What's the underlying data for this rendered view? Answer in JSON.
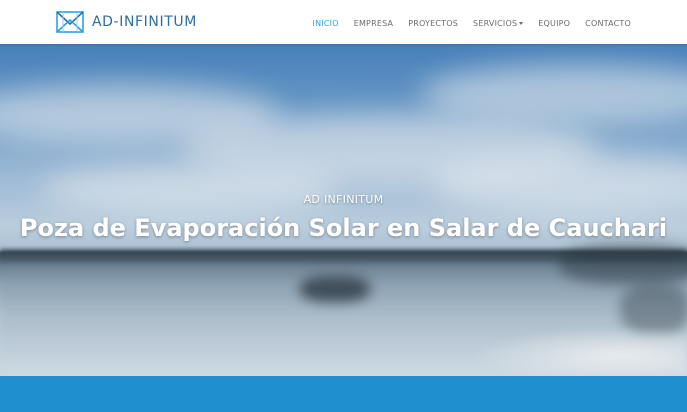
{
  "brand": {
    "name": "AD-INFINITUM",
    "logo_icon": "ad-infinitum-logo-icon",
    "color": "#2b6f9e"
  },
  "nav": {
    "items": [
      {
        "label": "INICIO",
        "active": true
      },
      {
        "label": "EMPRESA",
        "active": false
      },
      {
        "label": "PROYECTOS",
        "active": false
      },
      {
        "label": "SERVICIOS",
        "active": false,
        "dropdown": true
      },
      {
        "label": "EQUIPO",
        "active": false
      },
      {
        "label": "CONTACTO",
        "active": false
      }
    ],
    "active_color": "#2aa3e0",
    "text_color": "#6b6b6b"
  },
  "hero": {
    "subtitle": "AD INFINITUM",
    "title": "Poza de Evaporación Solar en Salar de Cauchari"
  },
  "accent_band_color": "#1f8fcf"
}
